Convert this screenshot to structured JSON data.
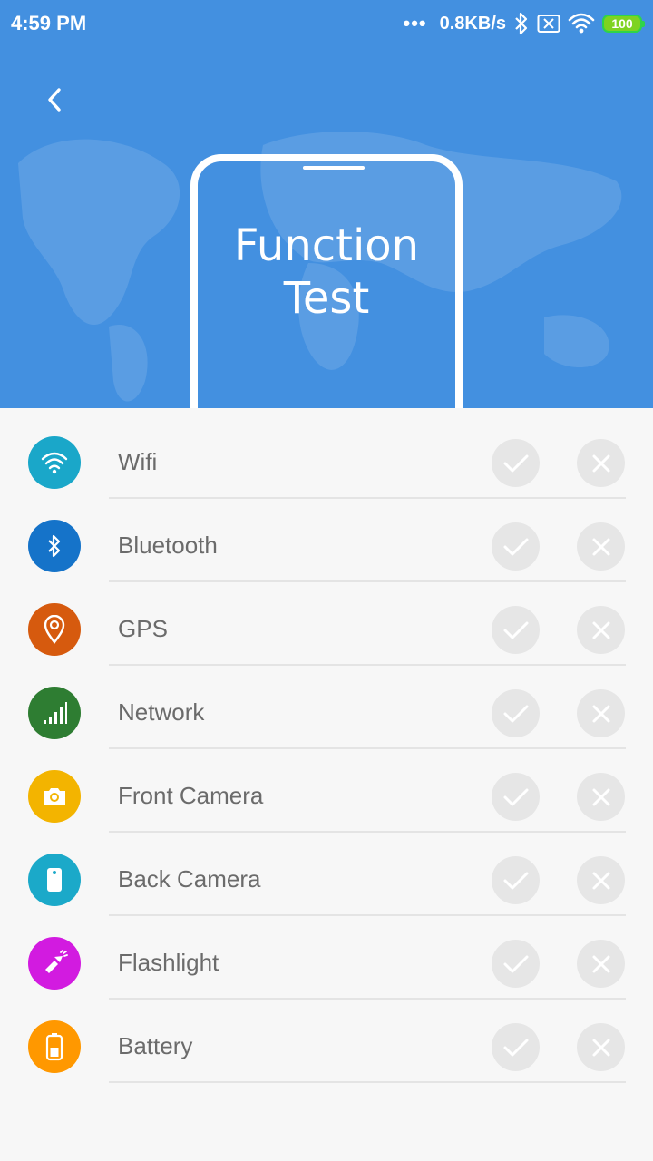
{
  "status_bar": {
    "time": "4:59 PM",
    "dots": "•••",
    "speed": "0.8KB/s",
    "battery": "100",
    "battery_color": "#7ed321"
  },
  "header": {
    "background": "#4390e0",
    "title_line1": "Function",
    "title_line2": "Test",
    "back_icon": "chevron-left-icon"
  },
  "tests": [
    {
      "label": "Wifi",
      "icon": "wifi-icon",
      "color": "#1aa7c9"
    },
    {
      "label": "Bluetooth",
      "icon": "bluetooth-icon",
      "color": "#1573c9"
    },
    {
      "label": "GPS",
      "icon": "location-pin-icon",
      "color": "#d65a0e"
    },
    {
      "label": "Network",
      "icon": "signal-icon",
      "color": "#2e7d32"
    },
    {
      "label": "Front Camera",
      "icon": "camera-icon",
      "color": "#f3b400"
    },
    {
      "label": "Back Camera",
      "icon": "phone-back-icon",
      "color": "#1ba9c9"
    },
    {
      "label": "Flashlight",
      "icon": "flashlight-icon",
      "color": "#d21be0"
    },
    {
      "label": "Battery",
      "icon": "battery-icon",
      "color": "#ff9800"
    }
  ]
}
